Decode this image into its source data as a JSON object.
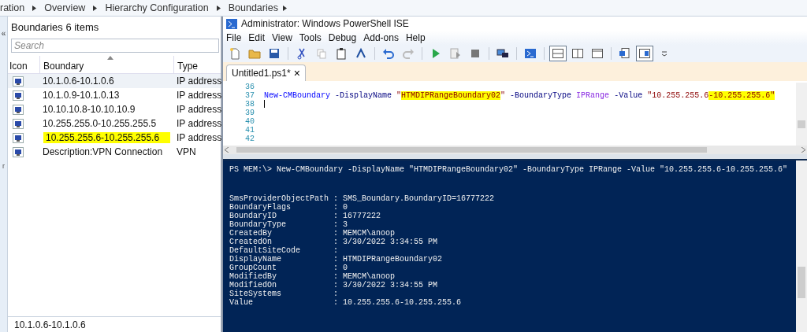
{
  "breadcrumb": [
    "ration",
    "Overview",
    "Hierarchy Configuration",
    "Boundaries"
  ],
  "console_nav": {
    "collapse_glyph": "«",
    "fragment": "r"
  },
  "boundaries_panel": {
    "title": "Boundaries 6 items",
    "search": {
      "placeholder": "Search"
    },
    "columns": [
      {
        "label": "Icon",
        "sorted": false
      },
      {
        "label": "Boundary",
        "sorted": true
      },
      {
        "label": "Type",
        "sorted": false
      }
    ],
    "rows": [
      {
        "boundary": "10.1.0.6-10.1.0.6",
        "type": "IP address",
        "selected": true,
        "highlighted": false
      },
      {
        "boundary": "10.1.0.9-10.1.0.13",
        "type": "IP address",
        "selected": false,
        "highlighted": false
      },
      {
        "boundary": "10.10.10.8-10.10.10.9",
        "type": "IP address",
        "selected": false,
        "highlighted": false
      },
      {
        "boundary": "10.255.255.0-10.255.255.5",
        "type": "IP address",
        "selected": false,
        "highlighted": false
      },
      {
        "boundary": "10.255.255.6-10.255.255.6",
        "type": "IP address",
        "selected": false,
        "highlighted": true
      },
      {
        "boundary": "Description:VPN Connection",
        "type": "VPN",
        "selected": false,
        "highlighted": false
      }
    ],
    "details": "10.1.0.6-10.1.0.6"
  },
  "ise": {
    "window": {
      "title": "Administrator: Windows PowerShell ISE"
    },
    "menu": [
      "File",
      "Edit",
      "View",
      "Tools",
      "Debug",
      "Add-ons",
      "Help"
    ],
    "toolbar": [
      {
        "kind": "new",
        "pressed": false
      },
      {
        "kind": "open",
        "pressed": false
      },
      {
        "kind": "save",
        "pressed": false
      },
      {
        "kind": "sep"
      },
      {
        "kind": "cut",
        "pressed": false
      },
      {
        "kind": "copy",
        "pressed": false
      },
      {
        "kind": "paste",
        "pressed": false
      },
      {
        "kind": "clear",
        "pressed": false
      },
      {
        "kind": "sep"
      },
      {
        "kind": "undo",
        "pressed": false
      },
      {
        "kind": "redo",
        "pressed": false
      },
      {
        "kind": "sep"
      },
      {
        "kind": "run",
        "pressed": false
      },
      {
        "kind": "runsel",
        "pressed": false
      },
      {
        "kind": "stop",
        "pressed": false
      },
      {
        "kind": "sep"
      },
      {
        "kind": "remote",
        "pressed": false
      },
      {
        "kind": "sep"
      },
      {
        "kind": "shell",
        "pressed": false
      },
      {
        "kind": "sep"
      },
      {
        "kind": "layout_top",
        "pressed": true
      },
      {
        "kind": "layout_right",
        "pressed": false
      },
      {
        "kind": "layout_max",
        "pressed": false
      },
      {
        "kind": "sep"
      },
      {
        "kind": "show_script",
        "pressed": false
      },
      {
        "kind": "addon",
        "pressed": true
      },
      {
        "kind": "more",
        "pressed": false
      }
    ],
    "tabs": [
      {
        "label": "Untitled1.ps1*",
        "selected": true,
        "close": "×"
      }
    ],
    "editor": {
      "lines": [
        {
          "number": "36"
        },
        {
          "number": "37",
          "tokens": [
            {
              "text": "New-CMBoundary",
              "kind": "command",
              "highlighted": false
            },
            {
              "text": " -DisplayName ",
              "kind": "parameter",
              "highlighted": false
            },
            {
              "text": "\"",
              "kind": "string",
              "highlighted": false
            },
            {
              "text": "HTMDIPRangeBoundary02",
              "kind": "string",
              "highlighted": true
            },
            {
              "text": "\"",
              "kind": "string",
              "highlighted": false
            },
            {
              "text": " -BoundaryType ",
              "kind": "parameter",
              "highlighted": false
            },
            {
              "text": "IPRange",
              "kind": "type",
              "highlighted": false
            },
            {
              "text": " -Value ",
              "kind": "parameter",
              "highlighted": false
            },
            {
              "text": "\"10.255.255.6",
              "kind": "string",
              "highlighted": false
            },
            {
              "text": "-10.255.255.6\"",
              "kind": "string",
              "highlighted": true
            }
          ]
        },
        {
          "number": "38"
        },
        {
          "number": "39"
        },
        {
          "number": "40"
        },
        {
          "number": "41"
        },
        {
          "number": "42"
        }
      ]
    },
    "console": {
      "command": "PS MEM:\\> New-CMBoundary -DisplayName \"HTMDIPRangeBoundary02\" -BoundaryType IPRange -Value \"10.255.255.6-10.255.255.6\"",
      "output": [
        "SmsProviderObjectPath : SMS_Boundary.BoundaryID=16777222",
        "BoundaryFlags         : 0",
        "BoundaryID            : 16777222",
        "BoundaryType          : 3",
        "CreatedBy             : MEMCM\\anoop",
        "CreatedOn             : 3/30/2022 3:34:55 PM",
        "DefaultSiteCode       :",
        "DisplayName           : HTMDIPRangeBoundary02",
        "GroupCount            : 0",
        "ModifiedBy            : MEMCM\\anoop",
        "ModifiedOn            : 3/30/2022 3:34:55 PM",
        "SiteSystems           :",
        "Value                 : 10.255.255.6-10.255.255.6"
      ]
    }
  }
}
